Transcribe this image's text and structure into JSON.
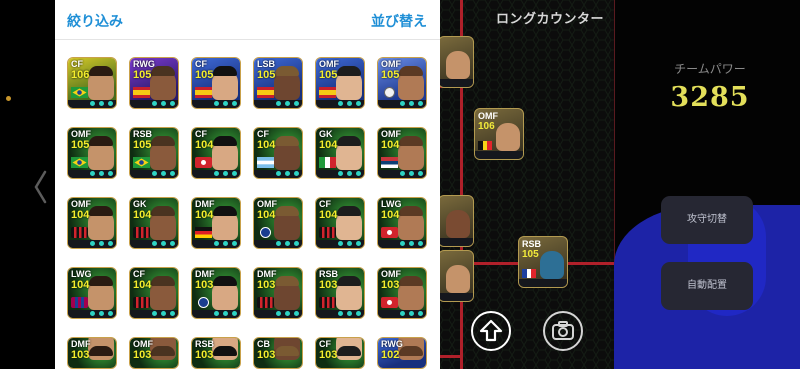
{
  "header": {
    "filter_label": "絞り込み",
    "sort_label": "並び替え"
  },
  "formation_title": "ロングカウンター",
  "team_power": {
    "label": "チームパワー",
    "value": "3285"
  },
  "side_buttons": {
    "switch_label": "攻守切替",
    "auto_label": "自動配置"
  },
  "pitch_cards": [
    {
      "position": "OMF",
      "rating": "106",
      "flag": "belgium"
    },
    {
      "position": "RSB",
      "rating": "105",
      "flag": "france"
    }
  ],
  "cards": [
    {
      "position": "CF",
      "rating": "106",
      "flag": "brazil",
      "bg": "yellow-green"
    },
    {
      "position": "RWG",
      "rating": "105",
      "flag": "spain",
      "bg": "purple"
    },
    {
      "position": "CF",
      "rating": "105",
      "flag": "spain",
      "bg": "blue"
    },
    {
      "position": "LSB",
      "rating": "105",
      "flag": "spain",
      "bg": "blue"
    },
    {
      "position": "OMF",
      "rating": "105",
      "flag": "spain",
      "bg": "blue"
    },
    {
      "position": "OMF",
      "rating": "105",
      "flag": "club-white",
      "bg": "blue-light"
    },
    {
      "position": "OMF",
      "rating": "105",
      "flag": "brazil",
      "bg": "dark-green"
    },
    {
      "position": "RSB",
      "rating": "105",
      "flag": "brazil",
      "bg": "dark-green"
    },
    {
      "position": "CF",
      "rating": "104",
      "flag": "club-red",
      "bg": "dark-green"
    },
    {
      "position": "CF",
      "rating": "104",
      "flag": "argentina",
      "bg": "dark-green"
    },
    {
      "position": "GK",
      "rating": "104",
      "flag": "italy",
      "bg": "dark-green"
    },
    {
      "position": "OMF",
      "rating": "104",
      "flag": "serbia",
      "bg": "dark-green"
    },
    {
      "position": "OMF",
      "rating": "104",
      "flag": "club-milan",
      "bg": "dark-green"
    },
    {
      "position": "GK",
      "rating": "104",
      "flag": "club-milan",
      "bg": "dark-green"
    },
    {
      "position": "DMF",
      "rating": "104",
      "flag": "germany",
      "bg": "dark-green"
    },
    {
      "position": "OMF",
      "rating": "104",
      "flag": "club-inter",
      "bg": "dark-green"
    },
    {
      "position": "CF",
      "rating": "104",
      "flag": "club-milan",
      "bg": "dark-green"
    },
    {
      "position": "LWG",
      "rating": "104",
      "flag": "club-red",
      "bg": "dark-green"
    },
    {
      "position": "LWG",
      "rating": "104",
      "flag": "club-barca",
      "bg": "dark-green"
    },
    {
      "position": "CF",
      "rating": "104",
      "flag": "club-milan",
      "bg": "dark-green"
    },
    {
      "position": "DMF",
      "rating": "103",
      "flag": "club-inter",
      "bg": "dark-green"
    },
    {
      "position": "DMF",
      "rating": "103",
      "flag": "club-milan",
      "bg": "dark-green"
    },
    {
      "position": "RSB",
      "rating": "103",
      "flag": "club-milan",
      "bg": "dark-green"
    },
    {
      "position": "OMF",
      "rating": "103",
      "flag": "club-red",
      "bg": "dark-green"
    },
    {
      "position": "DMF",
      "rating": "103",
      "flag": "none",
      "bg": "dark-green"
    },
    {
      "position": "OMF",
      "rating": "103",
      "flag": "none",
      "bg": "dark-green"
    },
    {
      "position": "RSB",
      "rating": "103",
      "flag": "none",
      "bg": "dark-green"
    },
    {
      "position": "CB",
      "rating": "103",
      "flag": "none",
      "bg": "dark-green"
    },
    {
      "position": "CF",
      "rating": "103",
      "flag": "none",
      "bg": "dark-green"
    },
    {
      "position": "RWG",
      "rating": "102",
      "flag": "none",
      "bg": "blue"
    }
  ],
  "icons": {
    "back": "chevron-left-icon",
    "arrow_up": "arrow-up-icon",
    "camera": "camera-icon"
  },
  "colors": {
    "accent": "#1f8fd6",
    "rating": "#f4ee2d",
    "team_power": "#e3df5a",
    "pitch_line": "#b0202a",
    "blue_shape": "#1d23a7"
  }
}
